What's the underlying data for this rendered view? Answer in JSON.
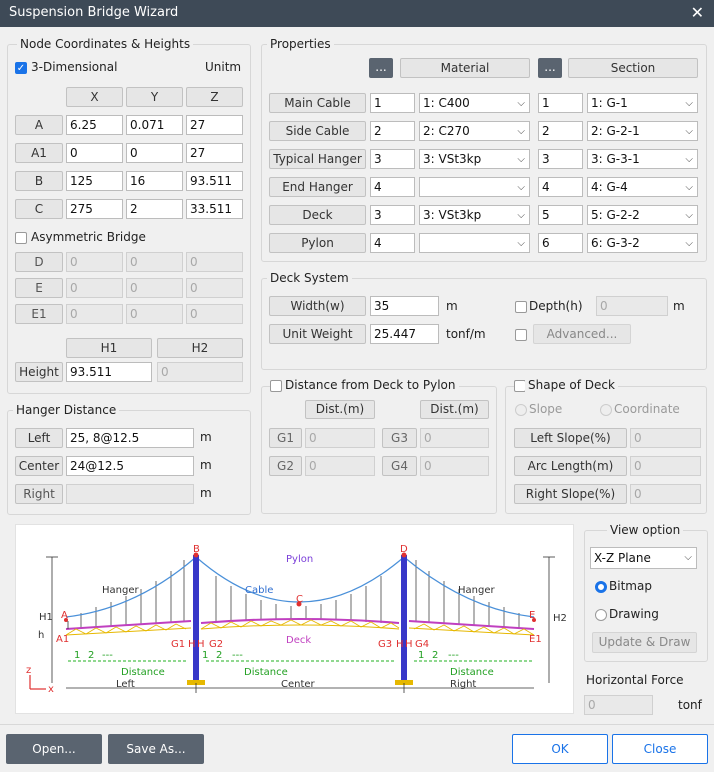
{
  "window": {
    "title": "Suspension Bridge Wizard",
    "close": "✕"
  },
  "node": {
    "group_title": "Node Coordinates & Heights",
    "dim3": "3-Dimensional",
    "unit": "Unitm",
    "col_x": "X",
    "col_y": "Y",
    "col_z": "Z",
    "rows": [
      {
        "label": "A",
        "x": "6.25",
        "y": "0.071",
        "z": "27"
      },
      {
        "label": "A1",
        "x": "0",
        "y": "0",
        "z": "27"
      },
      {
        "label": "B",
        "x": "125",
        "y": "16",
        "z": "93.511"
      },
      {
        "label": "C",
        "x": "275",
        "y": "2",
        "z": "33.511"
      }
    ],
    "asym": "Asymmetric Bridge",
    "arows": [
      {
        "label": "D",
        "x": "0",
        "y": "0",
        "z": "0"
      },
      {
        "label": "E",
        "x": "0",
        "y": "0",
        "z": "0"
      },
      {
        "label": "E1",
        "x": "0",
        "y": "0",
        "z": "0"
      }
    ],
    "h1": "H1",
    "h2": "H2",
    "height_label": "Height",
    "height_h1": "93.511",
    "height_h2": "0"
  },
  "hanger": {
    "group_title": "Hanger Distance",
    "left": "Left",
    "left_val": "25, 8@12.5",
    "center": "Center",
    "center_val": "24@12.5",
    "right": "Right",
    "right_val": "",
    "unit": "m"
  },
  "props": {
    "group_title": "Properties",
    "more": "...",
    "material": "Material",
    "section": "Section",
    "rows": [
      {
        "label": "Main Cable",
        "mat_no": "1",
        "mat": "1: C400",
        "sec_no": "1",
        "sec": "1: G-1"
      },
      {
        "label": "Side Cable",
        "mat_no": "2",
        "mat": "2: C270",
        "sec_no": "2",
        "sec": "2: G-2-1"
      },
      {
        "label": "Typical Hanger",
        "mat_no": "3",
        "mat": "3: VSt3kp",
        "sec_no": "3",
        "sec": "3: G-3-1"
      },
      {
        "label": "End Hanger",
        "mat_no": "4",
        "mat": "",
        "sec_no": "4",
        "sec": "4: G-4"
      },
      {
        "label": "Deck",
        "mat_no": "3",
        "mat": "3: VSt3kp",
        "sec_no": "5",
        "sec": "5: G-2-2"
      },
      {
        "label": "Pylon",
        "mat_no": "4",
        "mat": "",
        "sec_no": "6",
        "sec": "6: G-3-2"
      }
    ]
  },
  "deck": {
    "group_title": "Deck System",
    "width_label": "Width(w)",
    "width_val": "35",
    "width_unit": "m",
    "depth_label": "Depth(h)",
    "depth_val": "0",
    "depth_unit": "m",
    "uw_label": "Unit Weight",
    "uw_val": "25.447",
    "uw_unit": "tonf/m",
    "advanced": "Advanced..."
  },
  "dist": {
    "group_title": "Distance from Deck to Pylon",
    "dist_m": "Dist.(m)",
    "g1": "G1",
    "g1v": "0",
    "g2": "G2",
    "g2v": "0",
    "g3": "G3",
    "g3v": "0",
    "g4": "G4",
    "g4v": "0"
  },
  "shape": {
    "group_title": "Shape of Deck",
    "slope": "Slope",
    "coord": "Coordinate",
    "left_slope": "Left Slope(%)",
    "left_v": "0",
    "arc": "Arc Length(m)",
    "arc_v": "0",
    "right_slope": "Right Slope(%)",
    "right_v": "0"
  },
  "diagram": {
    "pylon": "Pylon",
    "cable": "Cable",
    "hanger_l": "Hanger",
    "hanger_r": "Hanger",
    "deck": "Deck",
    "B": "B",
    "D": "D",
    "C": "C",
    "A": "A",
    "A1": "A1",
    "E": "E",
    "E1": "E1",
    "H1": "H1",
    "H2": "H2",
    "h": "h",
    "G1": "G1",
    "G2": "G2",
    "G3": "G3",
    "G4": "G4",
    "H": "H",
    "z": "z",
    "x": "x",
    "n1": "1",
    "n2": "2",
    "dashes": "---",
    "dist_left": "Distance",
    "left": "Left",
    "dist_center": "Distance",
    "center": "Center",
    "dist_right": "Distance",
    "right": "Right"
  },
  "view": {
    "group_title": "View option",
    "plane": "X-Z Plane",
    "bitmap": "Bitmap",
    "drawing": "Drawing",
    "update": "Update & Draw"
  },
  "hforce": {
    "label": "Horizontal Force",
    "value": "0",
    "unit": "tonf"
  },
  "buttons": {
    "open": "Open...",
    "saveas": "Save As...",
    "ok": "OK",
    "close": "Close"
  }
}
